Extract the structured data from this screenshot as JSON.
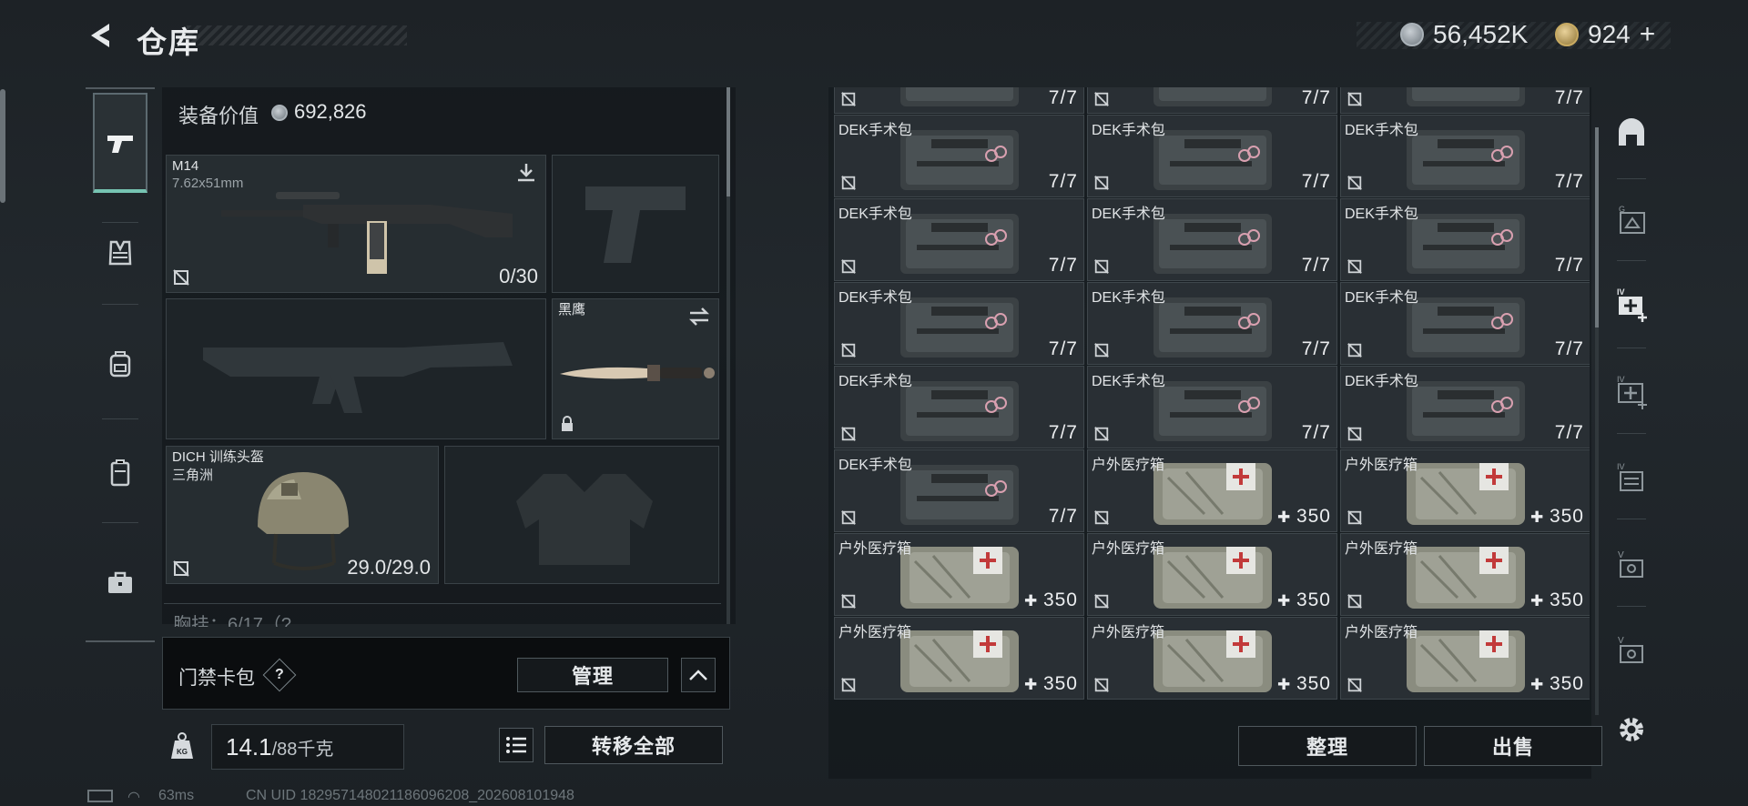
{
  "header": {
    "title": "仓库",
    "currency_silver": "56,452K",
    "currency_gold": "924",
    "gold_add": "+"
  },
  "equipment": {
    "value_label": "装备价值",
    "value": "692,826",
    "primary_weapon": {
      "name": "M14",
      "caliber": "7.62x51mm",
      "ammo": "0/30"
    },
    "melee": {
      "name": "黑鹰"
    },
    "helmet": {
      "name": "DICH 训练头盔",
      "faction": "三角洲",
      "durability": "29.0/29.0"
    },
    "chest_rig_partial": "胸挂：6/17（?"
  },
  "card_pack": {
    "label": "门禁卡包",
    "help": "?",
    "manage_button": "管理",
    "collapse_icon": "chevron-up-icon"
  },
  "bottom": {
    "weight_current": "14.1",
    "weight_max": "/88千克",
    "list_icon": "list-icon",
    "transfer_all_button": "转移全部"
  },
  "inventory": {
    "items": [
      {
        "name": "",
        "count": "7/7",
        "type": "dek"
      },
      {
        "name": "",
        "count": "7/7",
        "type": "dek"
      },
      {
        "name": "",
        "count": "7/7",
        "type": "dek"
      },
      {
        "name": "DEK手术包",
        "count": "7/7",
        "type": "dek"
      },
      {
        "name": "DEK手术包",
        "count": "7/7",
        "type": "dek"
      },
      {
        "name": "DEK手术包",
        "count": "7/7",
        "type": "dek"
      },
      {
        "name": "DEK手术包",
        "count": "7/7",
        "type": "dek"
      },
      {
        "name": "DEK手术包",
        "count": "7/7",
        "type": "dek"
      },
      {
        "name": "DEK手术包",
        "count": "7/7",
        "type": "dek"
      },
      {
        "name": "DEK手术包",
        "count": "7/7",
        "type": "dek"
      },
      {
        "name": "DEK手术包",
        "count": "7/7",
        "type": "dek"
      },
      {
        "name": "DEK手术包",
        "count": "7/7",
        "type": "dek"
      },
      {
        "name": "DEK手术包",
        "count": "7/7",
        "type": "dek"
      },
      {
        "name": "DEK手术包",
        "count": "7/7",
        "type": "dek"
      },
      {
        "name": "DEK手术包",
        "count": "7/7",
        "type": "dek"
      },
      {
        "name": "DEK手术包",
        "count": "7/7",
        "type": "dek"
      },
      {
        "name": "户外医疗箱",
        "count": "350",
        "type": "med"
      },
      {
        "name": "户外医疗箱",
        "count": "350",
        "type": "med"
      },
      {
        "name": "户外医疗箱",
        "count": "350",
        "type": "med"
      },
      {
        "name": "户外医疗箱",
        "count": "350",
        "type": "med"
      },
      {
        "name": "户外医疗箱",
        "count": "350",
        "type": "med"
      },
      {
        "name": "户外医疗箱",
        "count": "350",
        "type": "med"
      },
      {
        "name": "户外医疗箱",
        "count": "350",
        "type": "med"
      },
      {
        "name": "户外医疗箱",
        "count": "350",
        "type": "med"
      }
    ],
    "tidy_button": "整理",
    "sell_button": "出售"
  },
  "status_bar": {
    "ping": "63ms",
    "uid": "CN UID 18295714802118609​6208_202608101948"
  }
}
